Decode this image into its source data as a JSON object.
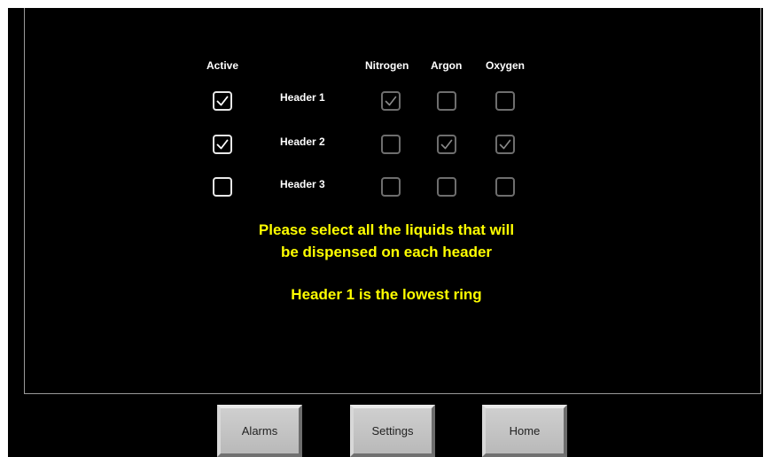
{
  "columns": {
    "active": "Active",
    "nitrogen": "Nitrogen",
    "argon": "Argon",
    "oxygen": "Oxygen"
  },
  "rows": [
    {
      "label": "Header 1",
      "active": true,
      "nitrogen": true,
      "argon": false,
      "oxygen": false
    },
    {
      "label": "Header 2",
      "active": true,
      "nitrogen": false,
      "argon": true,
      "oxygen": true
    },
    {
      "label": "Header 3",
      "active": false,
      "nitrogen": false,
      "argon": false,
      "oxygen": false
    }
  ],
  "message": {
    "line1": "Please select all the liquids that will",
    "line2": "be dispensed on each header",
    "line3": "Header 1 is the lowest ring"
  },
  "nav": {
    "alarms": "Alarms",
    "settings": "Settings",
    "home": "Home"
  },
  "colors": {
    "background": "#000000",
    "message_text": "#ffff00",
    "button_face": "#c4c4c4"
  }
}
